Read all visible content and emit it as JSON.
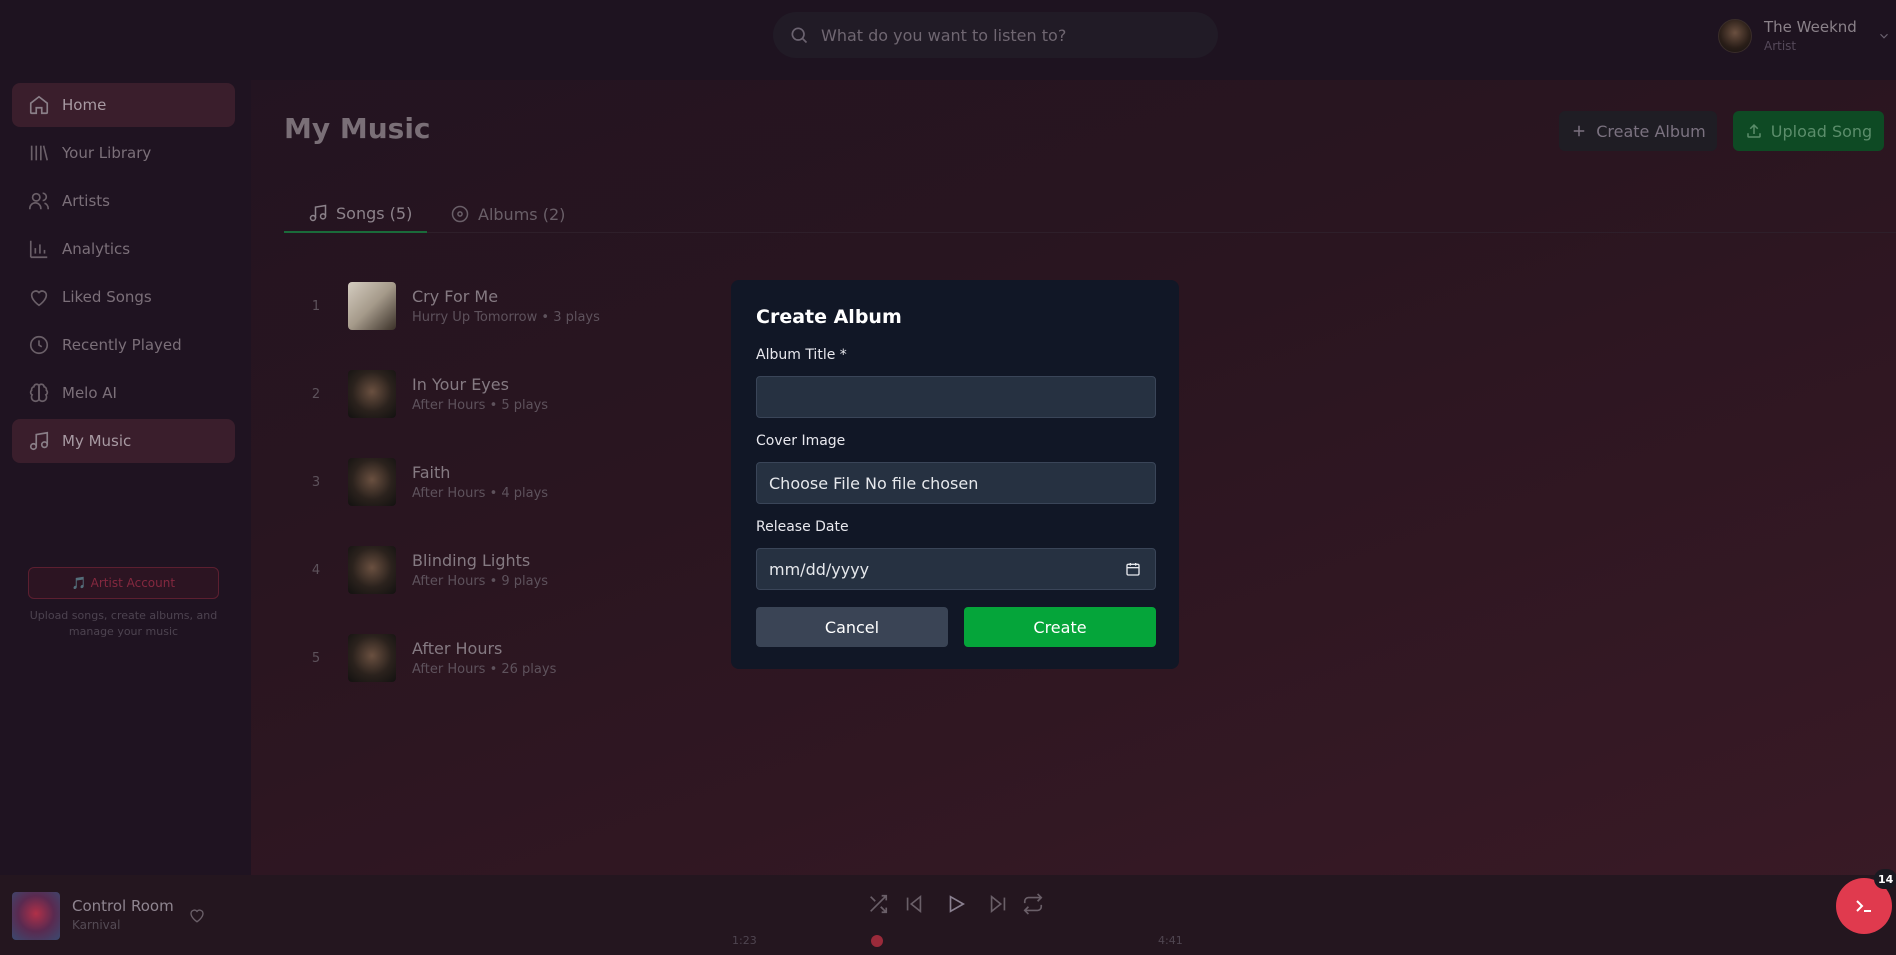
{
  "search": {
    "placeholder": "What do you want to listen to?"
  },
  "user": {
    "name": "The Weeknd",
    "role": "Artist"
  },
  "sidebar": {
    "items": [
      {
        "label": "Home",
        "icon": "home-icon",
        "active": true
      },
      {
        "label": "Your Library",
        "icon": "library-icon",
        "active": false
      },
      {
        "label": "Artists",
        "icon": "users-icon",
        "active": false
      },
      {
        "label": "Analytics",
        "icon": "chart-icon",
        "active": false
      },
      {
        "label": "Liked Songs",
        "icon": "heart-icon",
        "active": false
      },
      {
        "label": "Recently Played",
        "icon": "clock-icon",
        "active": false
      },
      {
        "label": "Melo AI",
        "icon": "brain-icon",
        "active": false
      },
      {
        "label": "My Music",
        "icon": "music-note-icon",
        "active": true
      }
    ],
    "artist_account_label": "🎵 Artist Account",
    "artist_account_desc": "Upload songs, create albums, and manage your music"
  },
  "main": {
    "title": "My Music",
    "create_album_label": "Create Album",
    "upload_song_label": "Upload Song",
    "tabs": [
      {
        "label": "Songs (5)",
        "active": true
      },
      {
        "label": "Albums (2)",
        "active": false
      }
    ],
    "songs": [
      {
        "num": "1",
        "title": "Cry For Me",
        "meta": "Hurry Up Tomorrow • 3 plays"
      },
      {
        "num": "2",
        "title": "In Your Eyes",
        "meta": "After Hours • 5 plays"
      },
      {
        "num": "3",
        "title": "Faith",
        "meta": "After Hours • 4 plays"
      },
      {
        "num": "4",
        "title": "Blinding Lights",
        "meta": "After Hours • 9 plays"
      },
      {
        "num": "5",
        "title": "After Hours",
        "meta": "After Hours • 26 plays"
      }
    ]
  },
  "modal": {
    "title": "Create Album",
    "album_title_label": "Album Title *",
    "album_title_value": "",
    "cover_image_label": "Cover Image",
    "cover_image_value": "Choose File No file chosen",
    "release_date_label": "Release Date",
    "release_date_value": "mm/dd/yyyy",
    "cancel_label": "Cancel",
    "create_label": "Create"
  },
  "player": {
    "title": "Control Room",
    "artist": "Karnival",
    "current_time": "1:23",
    "total_time": "4:41"
  },
  "fab": {
    "badge": "14"
  },
  "colors": {
    "accent_green": "#05a53a",
    "accent_red": "#e03a4e",
    "modal_bg": "#111726"
  }
}
